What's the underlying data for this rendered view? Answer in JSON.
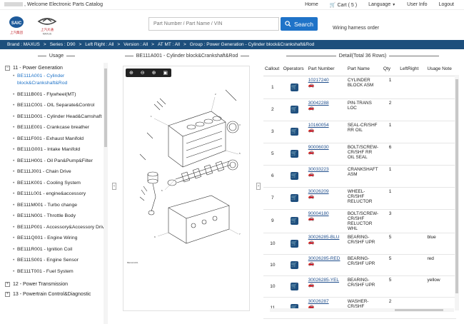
{
  "topbar": {
    "welcome": ", Welcome Electronic Parts Catalog",
    "home": "Home",
    "cart": "Cart ( 5 )",
    "language": "Language",
    "user_info": "User Info",
    "logout": "Logout"
  },
  "header": {
    "logo1_text": "上汽集团",
    "logo2_text": "上汽大通",
    "logo2_sub": "MAXUS",
    "search_placeholder": "Part Number / Part Name / VIN",
    "search_label": "Search",
    "wiring": "Wiring harness order"
  },
  "breadcrumb": [
    "Brand : MAXUS",
    "Series : D90",
    "Left Right : All",
    "Version : All",
    "AT MT : All",
    "Group : Power Generation - Cylinder block&Crankshaft&Rod"
  ],
  "panels": {
    "usage": "Usage",
    "diagram": "BE111A001 - Cylinder block&Crankshaft&Rod",
    "detail": "Detail(Total 36 Rows)"
  },
  "tree": {
    "group1": "11 - Power Generation",
    "items": [
      "BE111A001 - Cylinder block&Crankshaft&Rod",
      "BE111B001 - Flywheel(MT)",
      "BE111C001 - OIL Separate&Control",
      "BE111D001 - Cylinder Head&Camshaft",
      "BE111E001 - Crankcase breather",
      "BE111F001 - Exhaust Manifold",
      "BE111G001 - Intake Manifold",
      "BE111H001 - Oil Pan&Pump&Filter",
      "BE111J001 - Chain Drive",
      "BE111K001 - Cooling System",
      "BE111L001 - engine&accessory",
      "BE111M001 - Turbo change",
      "BE111N001 - Throttle Body",
      "BE111P001 - Accessory&Accessory Drive",
      "BE111Q001 - Engine Wiring",
      "BE111R001 - Ignition Coil",
      "BE111S001 - Engine Sensor",
      "BE111T001 - Fuel System"
    ],
    "group2": "12 - Power Transmission",
    "group3": "13 - Powertrain Control&Diagnostic"
  },
  "diagram_caption": "BE111A001",
  "table": {
    "headers": [
      "Callout",
      "Operators",
      "Part Number",
      "Part Name",
      "Qty",
      "LeftRight",
      "Usage Note"
    ],
    "rows": [
      {
        "callout": "1",
        "pn": "10217240",
        "name": "CYLINDER BLOCK ASM",
        "qty": "1",
        "lr": "",
        "note": ""
      },
      {
        "callout": "2",
        "pn": "30042288",
        "name": "PIN-TRANS LOC",
        "qty": "2",
        "lr": "",
        "note": ""
      },
      {
        "callout": "3",
        "pn": "10160054",
        "name": "SEAL-CR/SHF RR OIL",
        "qty": "1",
        "lr": "",
        "note": ""
      },
      {
        "callout": "5",
        "pn": "90006030",
        "name": "BOLT/SCREW-CR/SHF RR OIL SEAL",
        "qty": "6",
        "lr": "",
        "note": ""
      },
      {
        "callout": "6",
        "pn": "30033223",
        "name": "CRANKSHAFT ASM",
        "qty": "1",
        "lr": "",
        "note": ""
      },
      {
        "callout": "7",
        "pn": "30026209",
        "name": "WHEEL-CR/SHF RELUCTOR",
        "qty": "1",
        "lr": "",
        "note": ""
      },
      {
        "callout": "9",
        "pn": "90004180",
        "name": "BOLT/SCREW-CR/SHF RELUCTOR WHL",
        "qty": "3",
        "lr": "",
        "note": ""
      },
      {
        "callout": "10",
        "pn": "30026285-BLU",
        "name": "BEARING-CR/SHF UPR",
        "qty": "5",
        "lr": "",
        "note": "blue"
      },
      {
        "callout": "10",
        "pn": "30026285-RED",
        "name": "BEARING-CR/SHF UPR",
        "qty": "5",
        "lr": "",
        "note": "red"
      },
      {
        "callout": "10",
        "pn": "30026285-YEL",
        "name": "BEARING-CR/SHF UPR",
        "qty": "5",
        "lr": "",
        "note": "yellow"
      },
      {
        "callout": "11",
        "pn": "30026287",
        "name": "WASHER-CR/SHF",
        "qty": "2",
        "lr": "",
        "note": ""
      }
    ]
  },
  "colors": {
    "accent": "#1f73c8",
    "breadcrumb_bg": "#1d4f7c",
    "cart_button": "#1e4f7f"
  }
}
